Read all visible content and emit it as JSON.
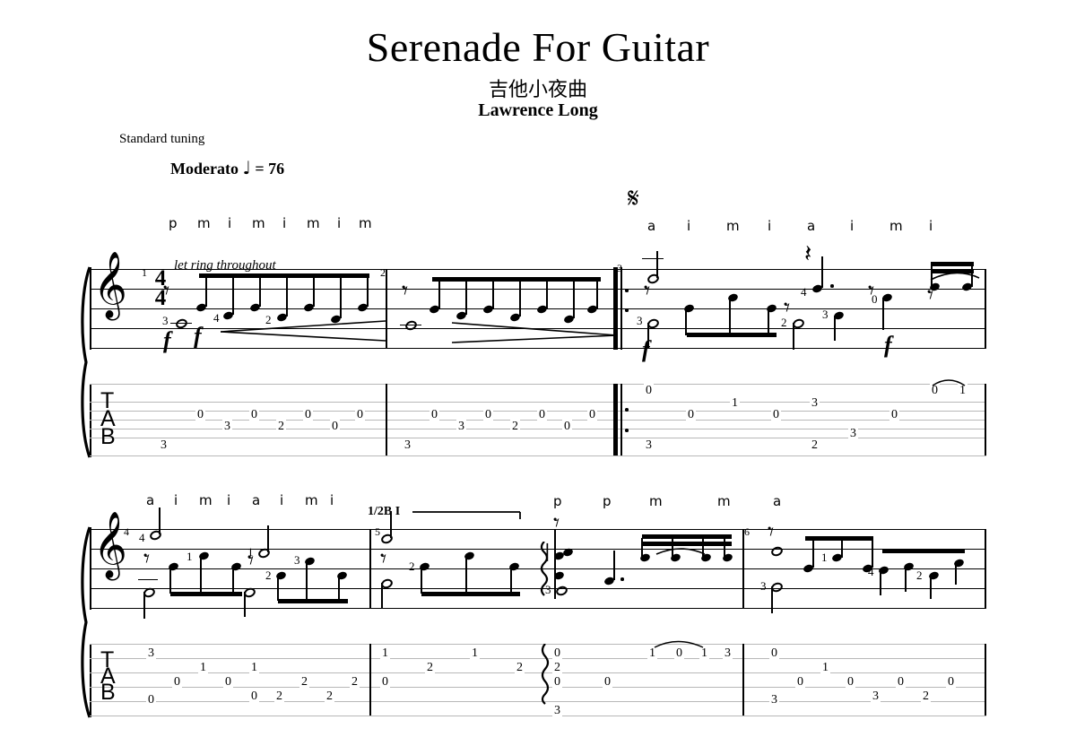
{
  "header": {
    "title": "Serenade For Guitar",
    "subtitle": "吉他小夜曲",
    "composer": "Lawrence Long",
    "tuning": "Standard tuning",
    "tempo_text": "Moderato",
    "tempo_note": "♩",
    "tempo_equals": "= 76"
  },
  "markings": {
    "let_ring": "let ring throughout",
    "barre": "1/2B I",
    "segno": "𝄋",
    "dynamic_f": "f",
    "tab_letters": [
      "T",
      "A",
      "B"
    ],
    "time_sig_top": "4",
    "time_sig_bottom": "4",
    "clef": "𝄞"
  },
  "system1": {
    "rh_fingering_m1": [
      "p",
      "m",
      "i",
      "m",
      "i",
      "m",
      "i",
      "m"
    ],
    "rh_fingering_m3": [
      "a",
      "i",
      "m",
      "i",
      "a",
      "i",
      "m",
      "i"
    ],
    "measure_numbers": [
      "1",
      "2",
      "3"
    ],
    "lh_fingering_m1": [
      "3",
      "4",
      "2"
    ],
    "lh_fingering_m2": [],
    "lh_fingering_m3": [
      "3",
      "4",
      "2",
      "3",
      "0"
    ],
    "tab": {
      "m1": [
        {
          "string": 6,
          "fret": "3"
        },
        {
          "string": 4,
          "fret": "0"
        },
        {
          "string": 3,
          "fret": "3"
        },
        {
          "string": 4,
          "fret": "0"
        },
        {
          "string": 3,
          "fret": "2"
        },
        {
          "string": 4,
          "fret": "0"
        },
        {
          "string": 3,
          "fret": "0"
        },
        {
          "string": 4,
          "fret": "0"
        }
      ],
      "m2": [
        {
          "string": 6,
          "fret": "3"
        },
        {
          "string": 4,
          "fret": "0"
        },
        {
          "string": 3,
          "fret": "3"
        },
        {
          "string": 4,
          "fret": "0"
        },
        {
          "string": 3,
          "fret": "2"
        },
        {
          "string": 4,
          "fret": "0"
        },
        {
          "string": 3,
          "fret": "0"
        },
        {
          "string": 4,
          "fret": "0"
        }
      ],
      "m3": [
        {
          "string": 6,
          "fret": "3"
        },
        {
          "string": 2,
          "fret": "0"
        },
        {
          "string": 4,
          "fret": "0"
        },
        {
          "string": 3,
          "fret": "1"
        },
        {
          "string": 4,
          "fret": "0"
        },
        {
          "string": 6,
          "fret": "2"
        },
        {
          "string": 3,
          "fret": "3"
        },
        {
          "string": 5,
          "fret": "3"
        },
        {
          "string": 4,
          "fret": "0"
        },
        {
          "string": 2,
          "fret": "0"
        },
        {
          "string": 2,
          "fret": "1"
        }
      ]
    }
  },
  "system2": {
    "rh_fingering_m4": [
      "a",
      "i",
      "m",
      "i",
      "a",
      "i",
      "m",
      "i"
    ],
    "rh_fingering_m5": [
      "p",
      "p",
      "m",
      "m",
      "a"
    ],
    "measure_numbers": [
      "4",
      "5",
      "6"
    ],
    "lh_fingering_m4": [
      "4",
      "4",
      "1",
      "1",
      "2",
      "3"
    ],
    "lh_fingering_m5": [
      "2",
      "3"
    ],
    "lh_fingering_m6": [
      "3",
      "1",
      "4",
      "2"
    ],
    "tab": {
      "m4": [
        {
          "string": 5,
          "fret": "0"
        },
        {
          "string": 2,
          "fret": "3"
        },
        {
          "string": 3,
          "fret": "0"
        },
        {
          "string": 2,
          "fret": "1"
        },
        {
          "string": 3,
          "fret": "0"
        },
        {
          "string": 2,
          "fret": "1"
        },
        {
          "string": 4,
          "fret": "0"
        },
        {
          "string": 3,
          "fret": "2"
        },
        {
          "string": 2,
          "fret": "2"
        },
        {
          "string": 3,
          "fret": "2"
        },
        {
          "string": 2,
          "fret": "2"
        }
      ],
      "m5": [
        {
          "string": 4,
          "fret": "0"
        },
        {
          "string": 2,
          "fret": "1"
        },
        {
          "string": 3,
          "fret": "2"
        },
        {
          "string": 2,
          "fret": "1"
        },
        {
          "string": 3,
          "fret": "2"
        },
        {
          "string": 2,
          "fret": "0"
        },
        {
          "string": 3,
          "fret": "2"
        },
        {
          "string": 4,
          "fret": "0"
        },
        {
          "string": 6,
          "fret": "3"
        },
        {
          "string": 4,
          "fret": "0"
        },
        {
          "string": 2,
          "fret": "1"
        },
        {
          "string": 2,
          "fret": "0"
        },
        {
          "string": 2,
          "fret": "1"
        },
        {
          "string": 2,
          "fret": "3"
        }
      ],
      "m6": [
        {
          "string": 6,
          "fret": "3"
        },
        {
          "string": 2,
          "fret": "0"
        },
        {
          "string": 3,
          "fret": "0"
        },
        {
          "string": 2,
          "fret": "1"
        },
        {
          "string": 3,
          "fret": "0"
        },
        {
          "string": 4,
          "fret": "3"
        },
        {
          "string": 3,
          "fret": "0"
        },
        {
          "string": 4,
          "fret": "2"
        },
        {
          "string": 3,
          "fret": "0"
        }
      ]
    }
  }
}
